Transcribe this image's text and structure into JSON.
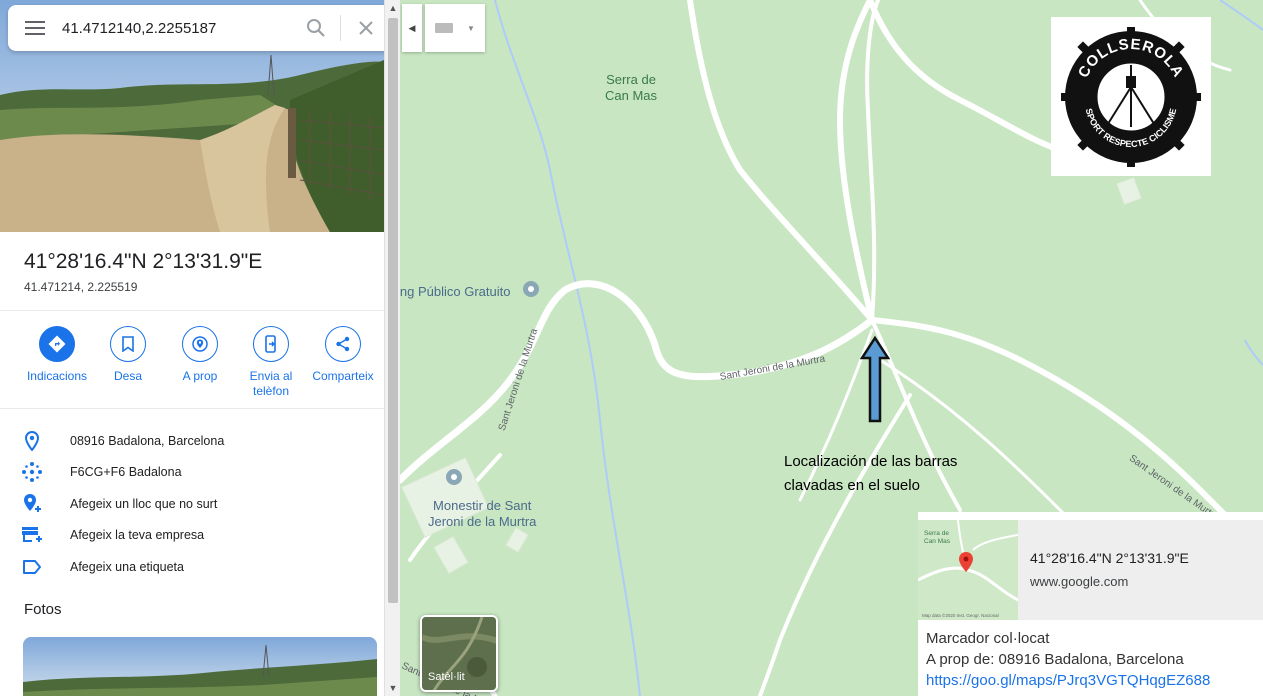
{
  "search": {
    "query": "41.4712140,2.2255187"
  },
  "place": {
    "title": "41°28'16.4\"N 2°13'31.9\"E",
    "subtitle": "41.471214, 2.225519"
  },
  "actions": [
    {
      "label": "Indicacions",
      "icon": "directions-icon"
    },
    {
      "label": "Desa",
      "icon": "bookmark-icon"
    },
    {
      "label": "A prop",
      "icon": "nearby-icon"
    },
    {
      "label": "Envia al telèfon",
      "icon": "send-to-phone-icon"
    },
    {
      "label": "Comparteix",
      "icon": "share-icon"
    }
  ],
  "info_rows": [
    {
      "text": "08916 Badalona, Barcelona",
      "icon": "location-pin-icon"
    },
    {
      "text": "F6CG+F6 Badalona",
      "icon": "plus-code-icon"
    },
    {
      "text": "Afegeix un lloc que no surt",
      "icon": "add-place-icon"
    },
    {
      "text": "Afegeix la teva empresa",
      "icon": "add-business-icon"
    },
    {
      "text": "Afegeix una etiqueta",
      "icon": "label-icon"
    }
  ],
  "photos": {
    "title": "Fotos"
  },
  "map": {
    "labels": {
      "serra": "Serra de\nCan Mas",
      "parking": "ing Público Gratuito",
      "monestir": "Monestir de Sant\nJeroni de la Murtra",
      "road_a": "Sant Jeroni de la Murtra",
      "road_b": "Sant Jeroni de la Murtra",
      "road_c": "Sant Jeroni de la Murtra",
      "road_d": "Sant Jeroni de la Murtra"
    },
    "annotation": [
      "Localización de las barras",
      "clavadas en el suelo"
    ],
    "satellite_label": "Satèl·lit",
    "logo": {
      "top_text": "COLLSEROLA",
      "bottom_text": "SPORT RESPECTE CICLISME"
    }
  },
  "share_card": {
    "thumb_label": "Serra de\nCan Mas",
    "thumb_footer": "Map data ©2020 Inst. Geogr. Nacional",
    "coords": "41°28'16.4\"N 2°13'31.9\"E",
    "site": "www.google.com",
    "line1": "Marcador col·locat",
    "line2": "A prop de: 08916 Badalona, Barcelona",
    "link": "https://goo.gl/maps/PJrq3VGTQHqgEZ688"
  },
  "colors": {
    "accent": "#1a73e8",
    "map_green": "#c8e6c2",
    "arrow_blue": "#5b9bd5"
  }
}
